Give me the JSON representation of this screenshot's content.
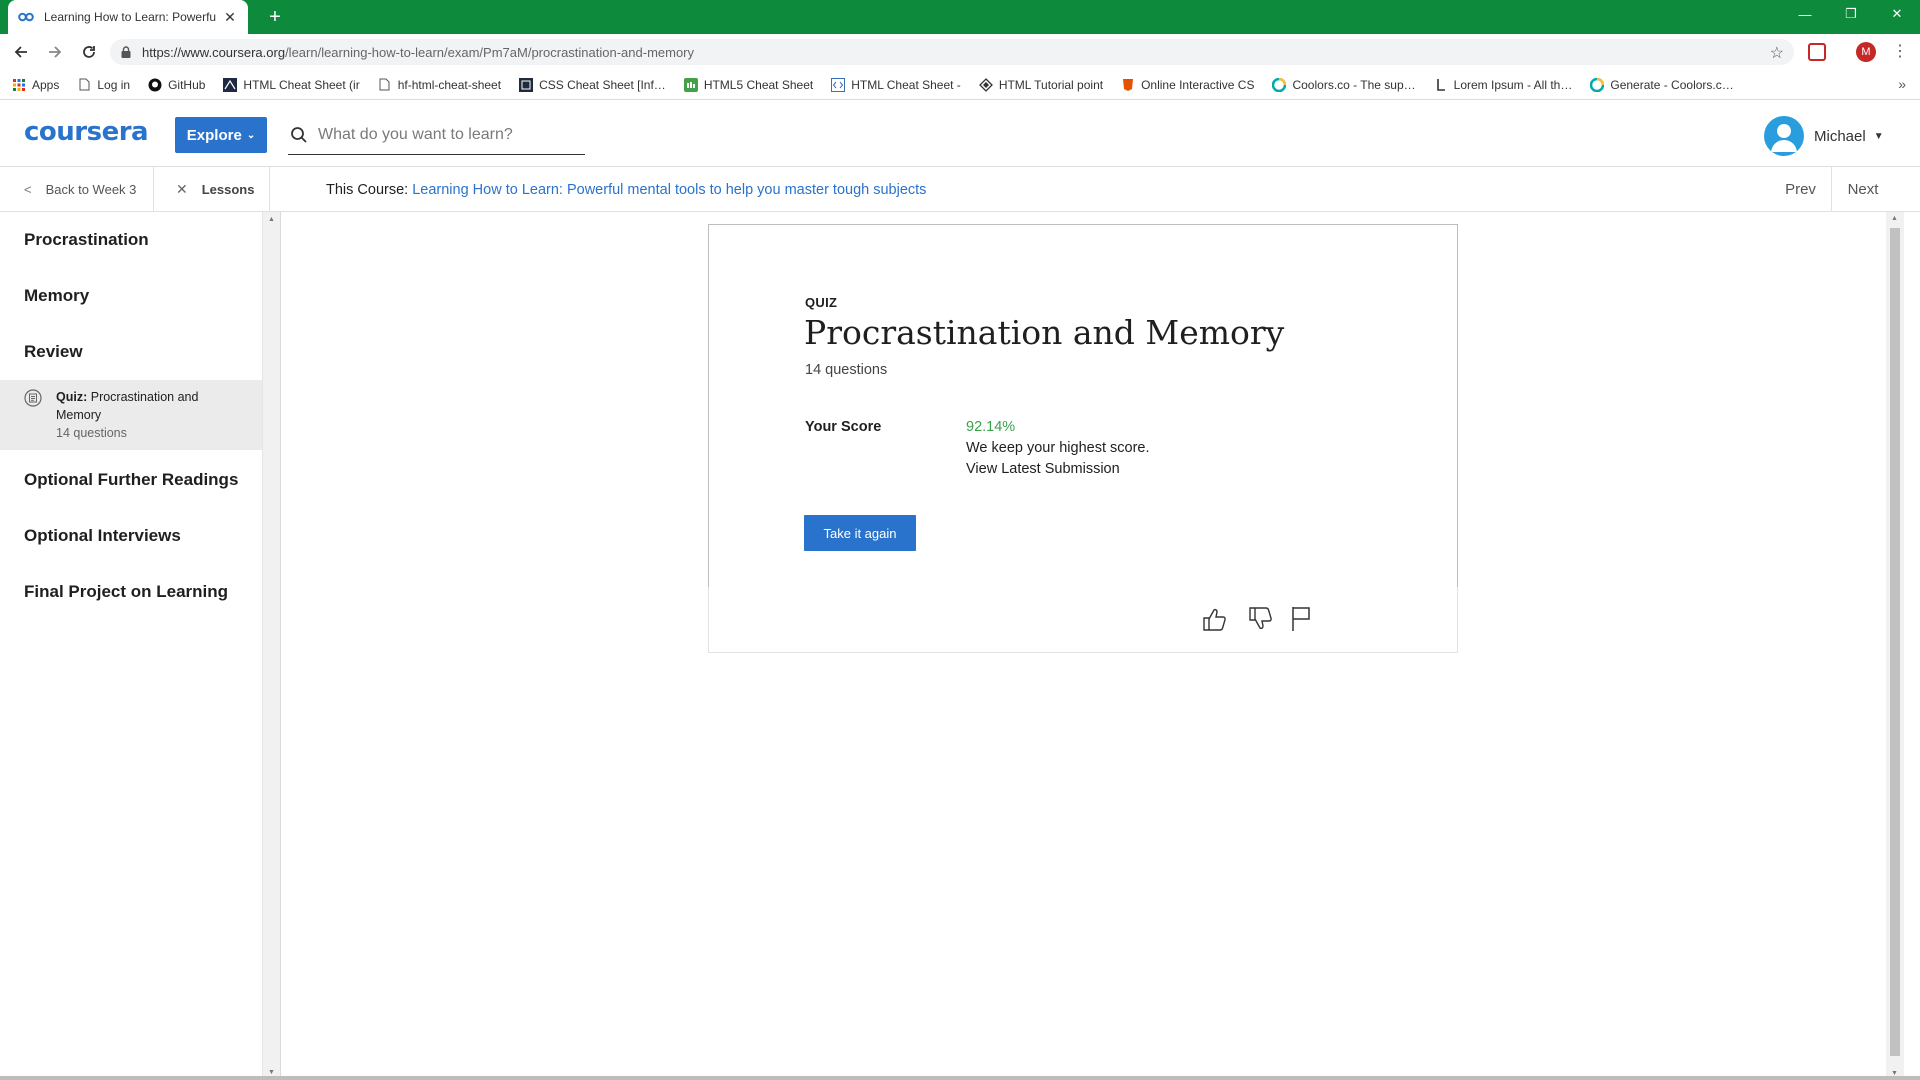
{
  "browser": {
    "tab_title": "Learning How to Learn: Powerful",
    "url_host": "https://www.coursera.org",
    "url_path": "/learn/learning-how-to-learn/exam/Pm7aM/procrastination-and-memory",
    "profile_initial": "M",
    "bookmarks": [
      {
        "label": "Apps",
        "icon": "apps-grid-icon"
      },
      {
        "label": "Log in",
        "icon": "page-icon"
      },
      {
        "label": "GitHub",
        "icon": "github-icon"
      },
      {
        "label": "HTML Cheat Sheet (ir",
        "icon": "html-icon"
      },
      {
        "label": "hf-html-cheat-sheet",
        "icon": "page-icon"
      },
      {
        "label": "CSS Cheat Sheet [Inf…",
        "icon": "css-icon"
      },
      {
        "label": "HTML5 Cheat Sheet",
        "icon": "html5-icon"
      },
      {
        "label": "HTML Cheat Sheet -",
        "icon": "code-icon"
      },
      {
        "label": "HTML Tutorial point",
        "icon": "diamond-icon"
      },
      {
        "label": "Online Interactive CS",
        "icon": "shield-icon"
      },
      {
        "label": "Coolors.co - The sup…",
        "icon": "coolors-icon"
      },
      {
        "label": "Lorem Ipsum - All th…",
        "icon": "lorem-icon"
      },
      {
        "label": "Generate - Coolors.c…",
        "icon": "coolors-icon"
      }
    ]
  },
  "header": {
    "logo": "coursera",
    "explore_label": "Explore",
    "search_placeholder": "What do you want to learn?",
    "user_name": "Michael"
  },
  "course_bar": {
    "back_label": "Back to Week 3",
    "lessons_label": "Lessons",
    "course_prefix": "This Course:",
    "course_name": "Learning How to Learn: Powerful mental tools to help you master tough subjects",
    "prev_label": "Prev",
    "next_label": "Next"
  },
  "sidebar": {
    "sections": [
      "Procrastination",
      "Memory",
      "Review",
      "Optional Further Readings",
      "Optional Interviews",
      "Final Project on Learning"
    ],
    "active_item": {
      "type_label": "Quiz:",
      "title": "Procrastination and Memory",
      "subtitle": "14 questions"
    }
  },
  "quiz": {
    "kicker": "QUIZ",
    "title": "Procrastination and Memory",
    "question_count": "14 questions",
    "score_label": "Your Score",
    "score_value": "92.14%",
    "score_note": "We keep your highest score.",
    "view_submission": "View Latest Submission",
    "retake_label": "Take it again"
  },
  "colors": {
    "brand_blue": "#2a73cc",
    "chrome_green": "#0e8a3d",
    "score_green": "#3aa14a"
  }
}
